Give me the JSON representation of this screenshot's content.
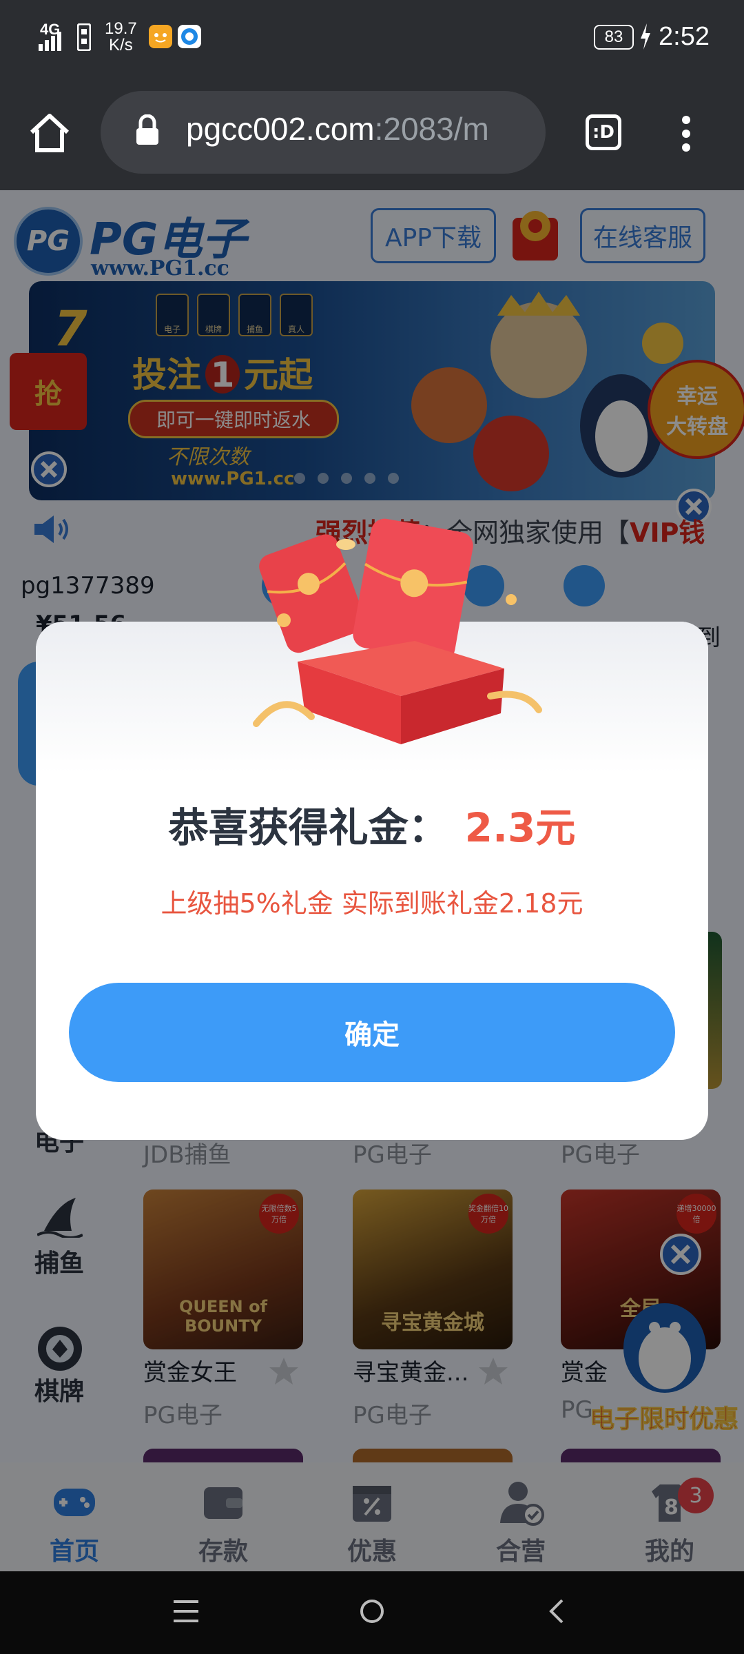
{
  "status_bar": {
    "network": "4G",
    "speed_value": "19.7",
    "speed_unit": "K/s",
    "battery": "83",
    "time": "2:52"
  },
  "browser": {
    "url_main": "pgcc002.com",
    "url_rest": ":2083/m",
    "tab_switch_label": ":D"
  },
  "site": {
    "logo_text": "PG电子",
    "logo_sub": "www.PG1.cc",
    "logo_badge": "PG",
    "app_download": "APP下载",
    "online_service": "在线客服",
    "banner": {
      "cats": [
        "电子",
        "棋牌",
        "捕鱼",
        "真人"
      ],
      "headline_a": "投注",
      "headline_num": "1",
      "headline_b": "元起",
      "ribbon": "即可一键即时返水",
      "tagline": "不限次数",
      "url": "www.PG1.cc",
      "left_badge": "抢",
      "wheel_text_1": "幸运",
      "wheel_text_2": "大转盘"
    },
    "marquee_red": "强烈推荐",
    "marquee_text": "：全网独家使用【",
    "marquee_vip": "VIP钱",
    "username": "pg1377389",
    "balance": "¥51.56",
    "quick_label": "到"
  },
  "games": {
    "row1_providers": [
      "JDB捕鱼",
      "PG电子",
      "PG电子"
    ],
    "row2": [
      {
        "title": "赏金女王",
        "provider": "PG电子",
        "badge": "无限倍数5万倍",
        "art": "QUEEN of BOUNTY"
      },
      {
        "title": "寻宝黄金...",
        "provider": "PG电子",
        "badge": "奖金翻倍10万倍",
        "art": "寻宝黄金城"
      },
      {
        "title": "赏金",
        "provider": "PG",
        "badge": "递增30000倍",
        "art": "全局"
      }
    ],
    "promo_float": "电子限时优惠"
  },
  "side_menu": {
    "items": [
      "电子",
      "捕鱼",
      "棋牌"
    ]
  },
  "modal": {
    "title": "恭喜获得礼金：",
    "amount": "2.3元",
    "note": "上级抽5%礼金 实际到账礼金2.18元",
    "confirm": "确定"
  },
  "tabs": [
    {
      "label": "首页",
      "icon": "gamepad-icon",
      "active": true
    },
    {
      "label": "存款",
      "icon": "wallet-icon",
      "active": false
    },
    {
      "label": "优惠",
      "icon": "coupon-icon",
      "active": false
    },
    {
      "label": "合营",
      "icon": "partner-icon",
      "active": false
    },
    {
      "label": "我的",
      "icon": "user-icon",
      "active": false,
      "badge": "3",
      "avatar_digit": "8"
    }
  ],
  "colors": {
    "accent": "#3d9bf8",
    "red": "#ee5a46",
    "tab_active": "#2f7fe0",
    "tab_inactive": "#6a7080"
  }
}
